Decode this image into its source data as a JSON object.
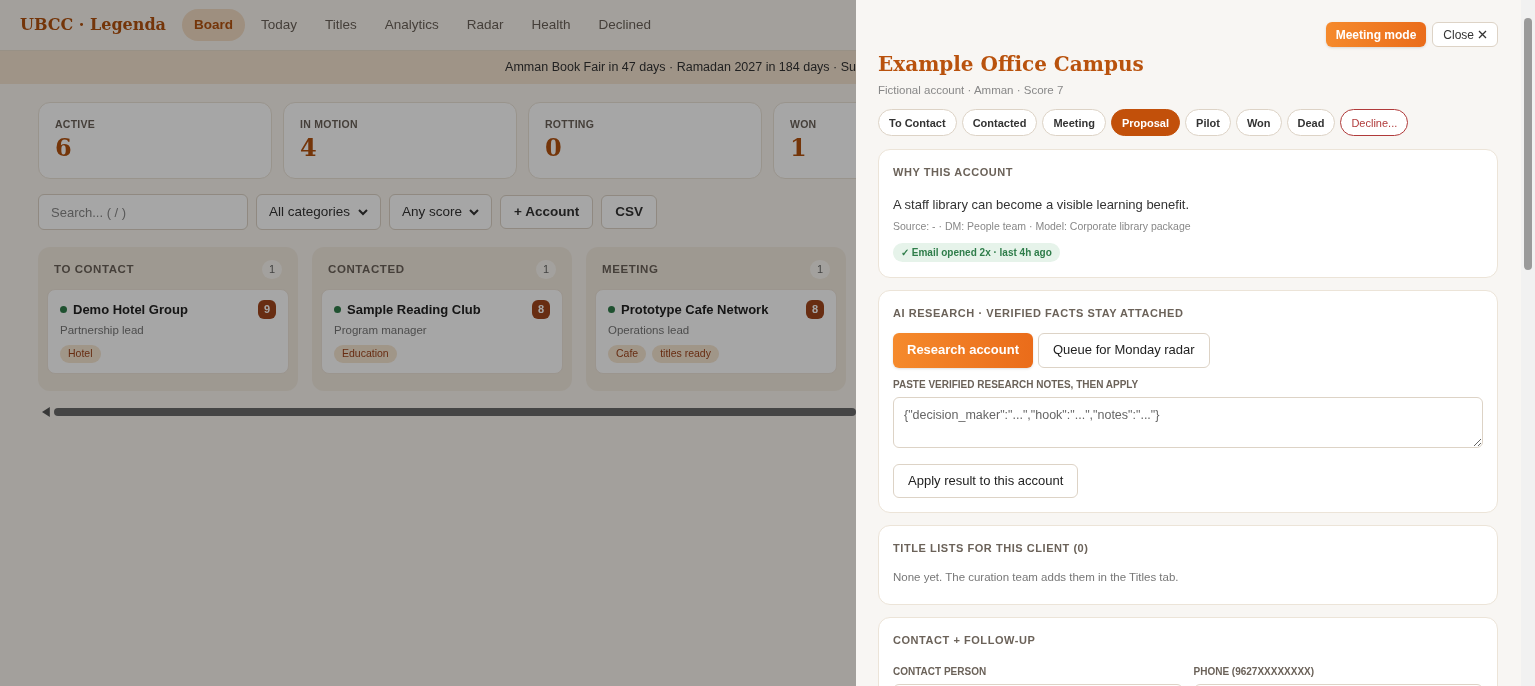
{
  "nav": {
    "brand": "UBCC · Legenda",
    "tabs": [
      {
        "label": "Board",
        "selected": true
      },
      {
        "label": "Today",
        "selected": false
      },
      {
        "label": "Titles",
        "selected": false
      },
      {
        "label": "Analytics",
        "selected": false
      },
      {
        "label": "Radar",
        "selected": false
      },
      {
        "label": "Health",
        "selected": false
      },
      {
        "label": "Declined",
        "selected": false
      }
    ]
  },
  "banner": "Amman Book Fair in 47 days · Ramadan 2027 in 184 days · Su",
  "stats": [
    {
      "label": "ACTIVE",
      "value": "6"
    },
    {
      "label": "IN MOTION",
      "value": "4"
    },
    {
      "label": "ROTTING",
      "value": "0"
    },
    {
      "label": "WON",
      "value": "1"
    }
  ],
  "toolbar": {
    "search": {
      "placeholder": "Search... ( / )"
    },
    "category": "All categories",
    "score": "Any score",
    "buttons": [
      "+ Account",
      "CSV"
    ]
  },
  "columns": [
    {
      "title": "TO CONTACT",
      "count": "1",
      "cards": [
        {
          "name": "Demo Hotel Group",
          "role": "Partnership lead",
          "score": "9",
          "color": "#1f5130",
          "tags": [
            "Hotel"
          ]
        }
      ]
    },
    {
      "title": "CONTACTED",
      "count": "1",
      "cards": [
        {
          "name": "Sample Reading Club",
          "role": "Program manager",
          "score": "8",
          "color": "#1f5130",
          "tags": [
            "Education"
          ]
        }
      ]
    },
    {
      "title": "MEETING",
      "count": "1",
      "cards": [
        {
          "name": "Prototype Cafe Network",
          "role": "Operations lead",
          "score": "8",
          "color": "#1f5130",
          "tags": [
            "Cafe",
            "titles ready"
          ]
        }
      ]
    }
  ],
  "drawer": {
    "meeting_button": "Meeting mode",
    "close_button": "Close",
    "title": "Example Office Campus",
    "subtitle": "Fictional account · Amman · Score 7",
    "stages": [
      {
        "label": "To Contact",
        "selected": false,
        "kind": "stage"
      },
      {
        "label": "Contacted",
        "selected": false,
        "kind": "stage"
      },
      {
        "label": "Meeting",
        "selected": false,
        "kind": "stage"
      },
      {
        "label": "Proposal",
        "selected": true,
        "kind": "stage"
      },
      {
        "label": "Pilot",
        "selected": false,
        "kind": "stage"
      },
      {
        "label": "Won",
        "selected": false,
        "kind": "stage"
      },
      {
        "label": "Dead",
        "selected": false,
        "kind": "stage"
      },
      {
        "label": "Decline...",
        "selected": false,
        "kind": "danger"
      }
    ],
    "why": {
      "heading": "WHY THIS ACCOUNT",
      "text": "A staff library can become a visible learning benefit.",
      "meta": "Source: - · DM: People team · Model: Corporate library package",
      "badge": "✓ Email opened 2x · last 4h ago"
    },
    "research": {
      "heading": "AI RESEARCH · VERIFIED FACTS STAY ATTACHED",
      "primary_button": "Research account",
      "secondary_button": "Queue for Monday radar",
      "notes_label": "PASTE VERIFIED RESEARCH NOTES, THEN APPLY",
      "notes_placeholder": "{\"decision_maker\":\"...\",\"hook\":\"...\",\"notes\":\"...\"}",
      "apply_button": "Apply result to this account"
    },
    "titles": {
      "heading": "TITLE LISTS FOR THIS CLIENT (0)",
      "text": "None yet. The curation team adds them in the Titles tab."
    },
    "contact": {
      "heading": "CONTACT + FOLLOW-UP",
      "fields": [
        {
          "label": "CONTACT PERSON"
        },
        {
          "label": "PHONE (9627XXXXXXXX)"
        }
      ]
    }
  }
}
